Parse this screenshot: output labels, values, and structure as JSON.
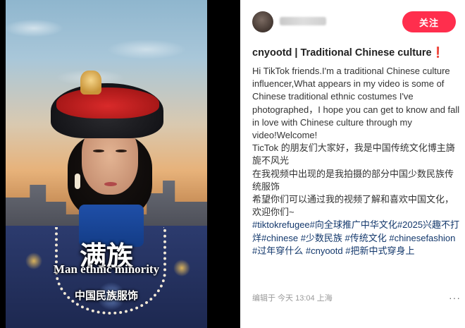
{
  "video": {
    "caption_big": "满族",
    "caption_en": "Man ethnic minority",
    "caption_small": "中国民族服饰"
  },
  "post": {
    "follow_label": "关注",
    "title": "cnyootd | Traditional Chinese culture",
    "title_flag": "❗",
    "body_en": "Hi TikTok friends.I'm a traditional Chinese culture influencer,What appears in my video is some of  Chinese traditional ethnic costumes I've photographed，I hope you can get to know and fall in love with Chinese culture through my video!Welcome!",
    "body_zh_1": "TicTok 的朋友们大家好，我是中国传统文化博主旖旎不风光",
    "body_zh_2": "在我视频中出现的是我拍摄的部分中国少数民族传统服饰",
    "body_zh_3": "希望你们可以通过我的视频了解和喜欢中国文化，欢迎你们~",
    "hashtags": [
      "#tiktokrefugee",
      "#向全球推广中华文化",
      "#2025兴趣不打烊",
      "#chinese",
      "#少数民族",
      "#传统文化",
      "#chinesefashion",
      "#过年穿什么",
      "#cnyootd",
      "#把新中式穿身上"
    ],
    "meta": "编辑于 今天 13:04 上海",
    "more": "···"
  },
  "colors": {
    "follow_bg": "#ff2e4d",
    "hashtag": "#13386c",
    "flag": "#e03131"
  },
  "icons": {
    "more": "more-options-icon"
  }
}
